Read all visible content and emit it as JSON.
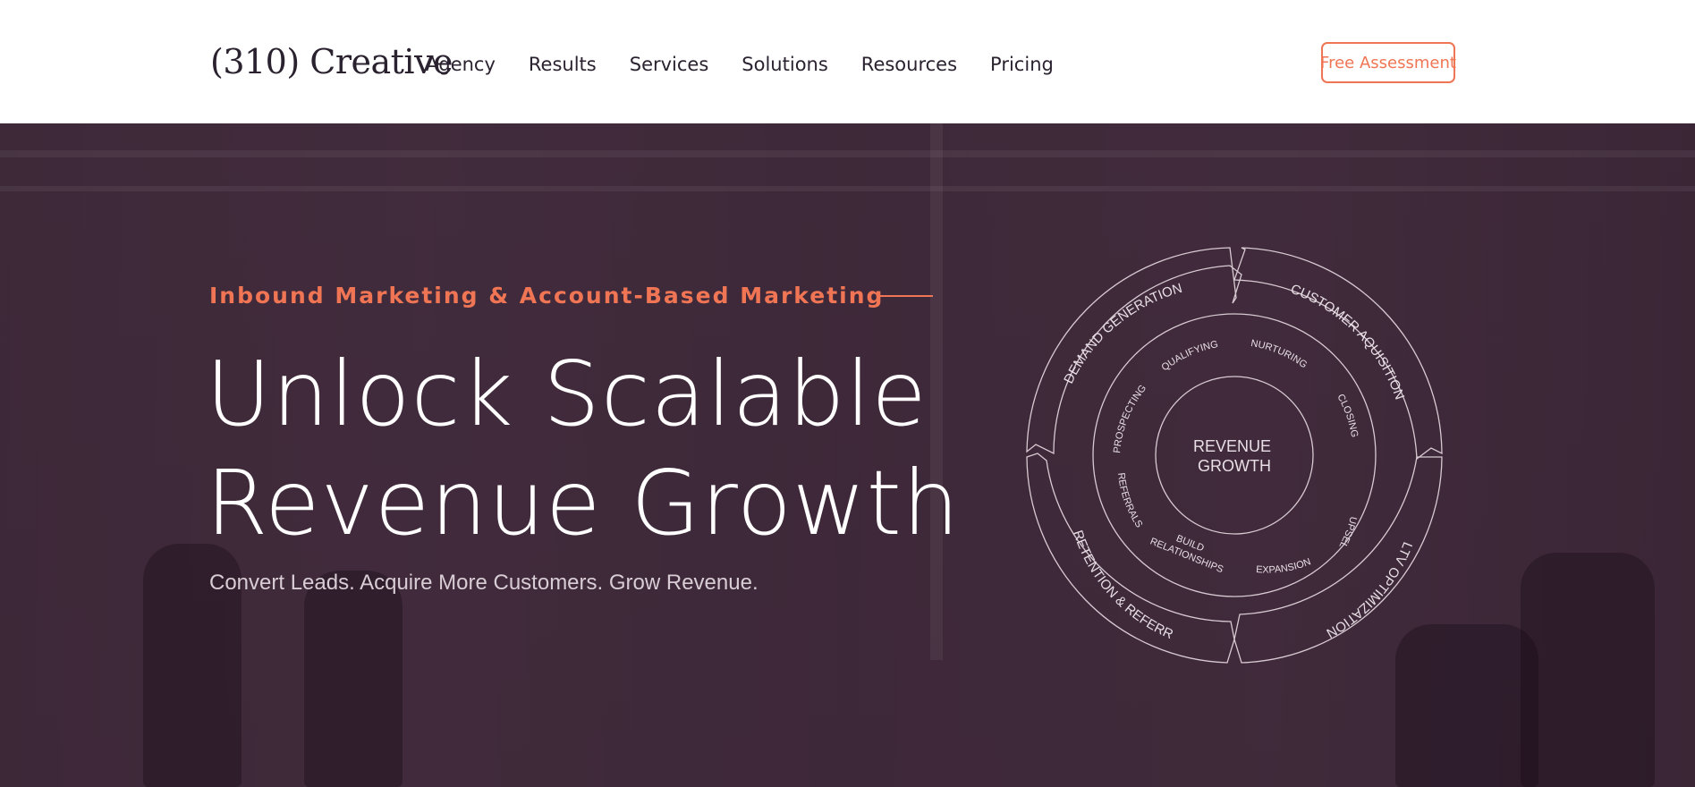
{
  "brand": {
    "logo_text": "(310) Creative"
  },
  "nav": {
    "items": [
      {
        "label": "Agency"
      },
      {
        "label": "Results"
      },
      {
        "label": "Services"
      },
      {
        "label": "Solutions"
      },
      {
        "label": "Resources"
      },
      {
        "label": "Pricing"
      }
    ],
    "cta_label": "Free Assessment"
  },
  "hero": {
    "eyebrow": "Inbound Marketing & Account-Based Marketing",
    "headline_line1": "Unlock Scalable",
    "headline_line2": "Revenue Growth",
    "subline": "Convert Leads. Acquire More Customers. Grow Revenue."
  },
  "wheel": {
    "center_line1": "REVENUE",
    "center_line2": "GROWTH",
    "outer": [
      "DEMAND GENERATION",
      "CUSTOMER  AQUISITION",
      "LTV OPTIMIZATION",
      "RETENTION & REFERRAL"
    ],
    "inner": [
      "QUALIFYING",
      "NURTURING",
      "CLOSING",
      "UPSELL",
      "EXPANSION",
      "BUILD",
      "RELATIONSHIPS",
      "REFERRALS",
      "PROSPECTING"
    ]
  },
  "colors": {
    "accent": "#f07554",
    "overlay": "#3a2a36",
    "text_dark": "#2b2230"
  }
}
